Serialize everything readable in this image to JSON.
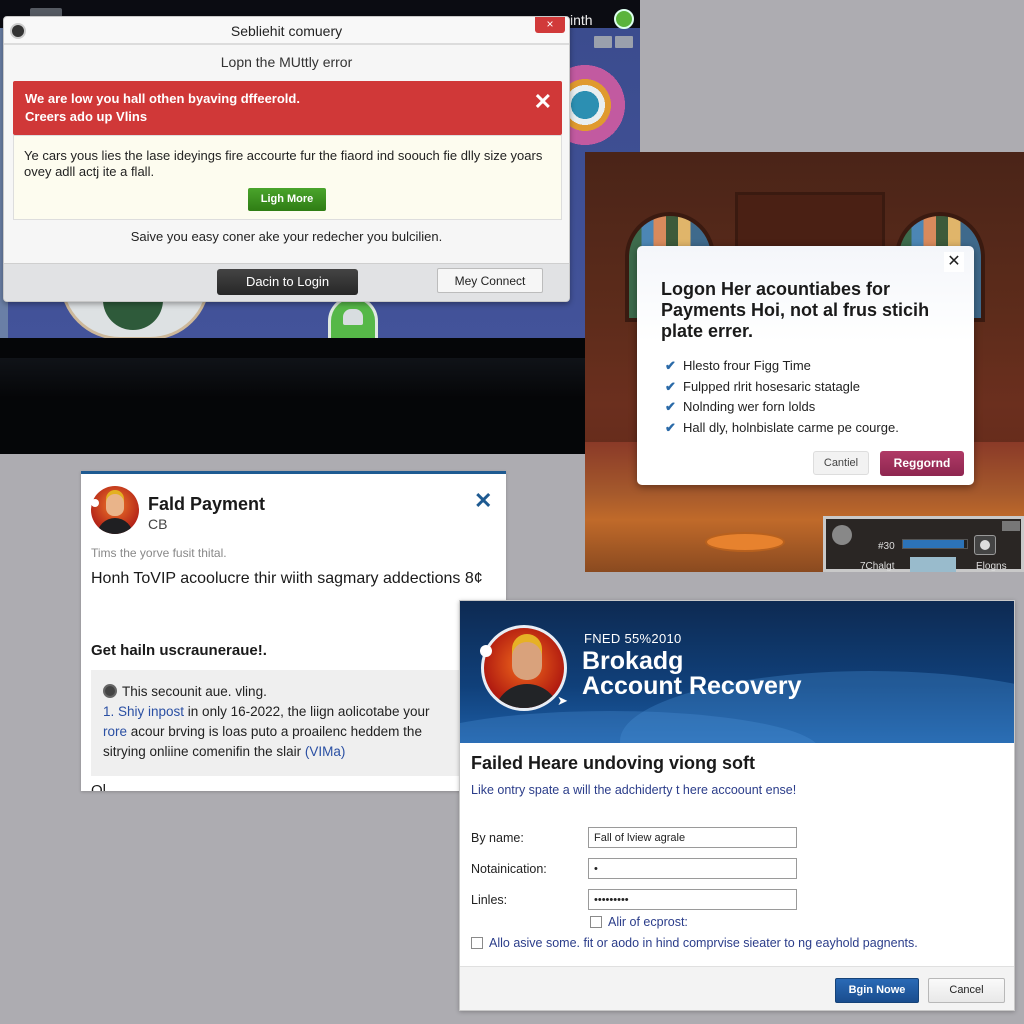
{
  "background": {
    "top_user_label": "cinth",
    "mini_player": {
      "value_label": "#30",
      "progress": 0.95,
      "left_label": "7Chalgt",
      "right_label": "Elogns"
    }
  },
  "dialog1": {
    "title": "Sebliehit comuery",
    "close_label": "×",
    "subtitle": "Lopn the MUttly error",
    "error_banner": {
      "line1": "We are low you hall othen byaving dffeerold.",
      "line2": "Creers ado up Vlins",
      "close_label": "✕"
    },
    "message": "Ye cars yous lies the lase ideyings fire accourte fur the fiaord ind soouch fie dlly size yoars ovey adll actj ite a flall.",
    "learn_more_button": "Ligh More",
    "note": "Saive you easy coner ake your redecher you bulcilien.",
    "primary_button": "Dacin to Login",
    "secondary_button": "Mey Connect"
  },
  "dialog2": {
    "close_label": "✕",
    "heading": "Logon Her acountiabes for Payments Hoi, not al frus sticih plate errer.",
    "checklist": [
      "Hlesto frour Figg Time",
      "Fulpped rlrit hosesaric statagle",
      "Nolnding wer forn lolds",
      "Hall dly, holnbislate carme pe courge."
    ],
    "cancel_button": "Cantiel",
    "primary_button": "Reggornd"
  },
  "dialog3": {
    "name": "Fald Payment",
    "sub": "CB",
    "close_label": "✕",
    "hint": "Tims the yorve fusit thital.",
    "body": "Honh ToVIP acoolucre thir wiith sagmary addections 8¢",
    "section_title": "Get hailn uscrauneraue!.",
    "info": {
      "line1": "This secounit aue. vling.",
      "step_prefix": "1. Shiy inpost",
      "step_text1": " in only 16-2022, the liign aolicotabe your",
      "link2": "rore",
      "step_text2": " acour brving is loas puto a proailenc heddem the",
      "step_text3": "sitrying onliine comenifin the slair ",
      "link3": "(VIMa)"
    },
    "cut_text": "Ol"
  },
  "dialog4": {
    "code": "FNED 55%2010",
    "brand": "Brokadg",
    "product": "Account Recovery",
    "heading": "Failed Heare undoving viong soft",
    "description": "Like ontry spate a will the adchiderty t here accoount ense!",
    "fields": [
      {
        "label": "By name:",
        "value": "Fall of lview agrale"
      },
      {
        "label": "Notainication:",
        "value": "•"
      },
      {
        "label": "Linles:",
        "value": "•••••••••"
      }
    ],
    "checkbox_inline": {
      "label": "Alir of ecprost:",
      "checked": false
    },
    "checkbox_agree": {
      "label": "Allo asive some. fit or aodo in hind comprvise sieater to ng eayhold pagnents.",
      "checked": false
    },
    "primary_button": "Bgin Nowe",
    "cancel_button": "Cancel"
  }
}
